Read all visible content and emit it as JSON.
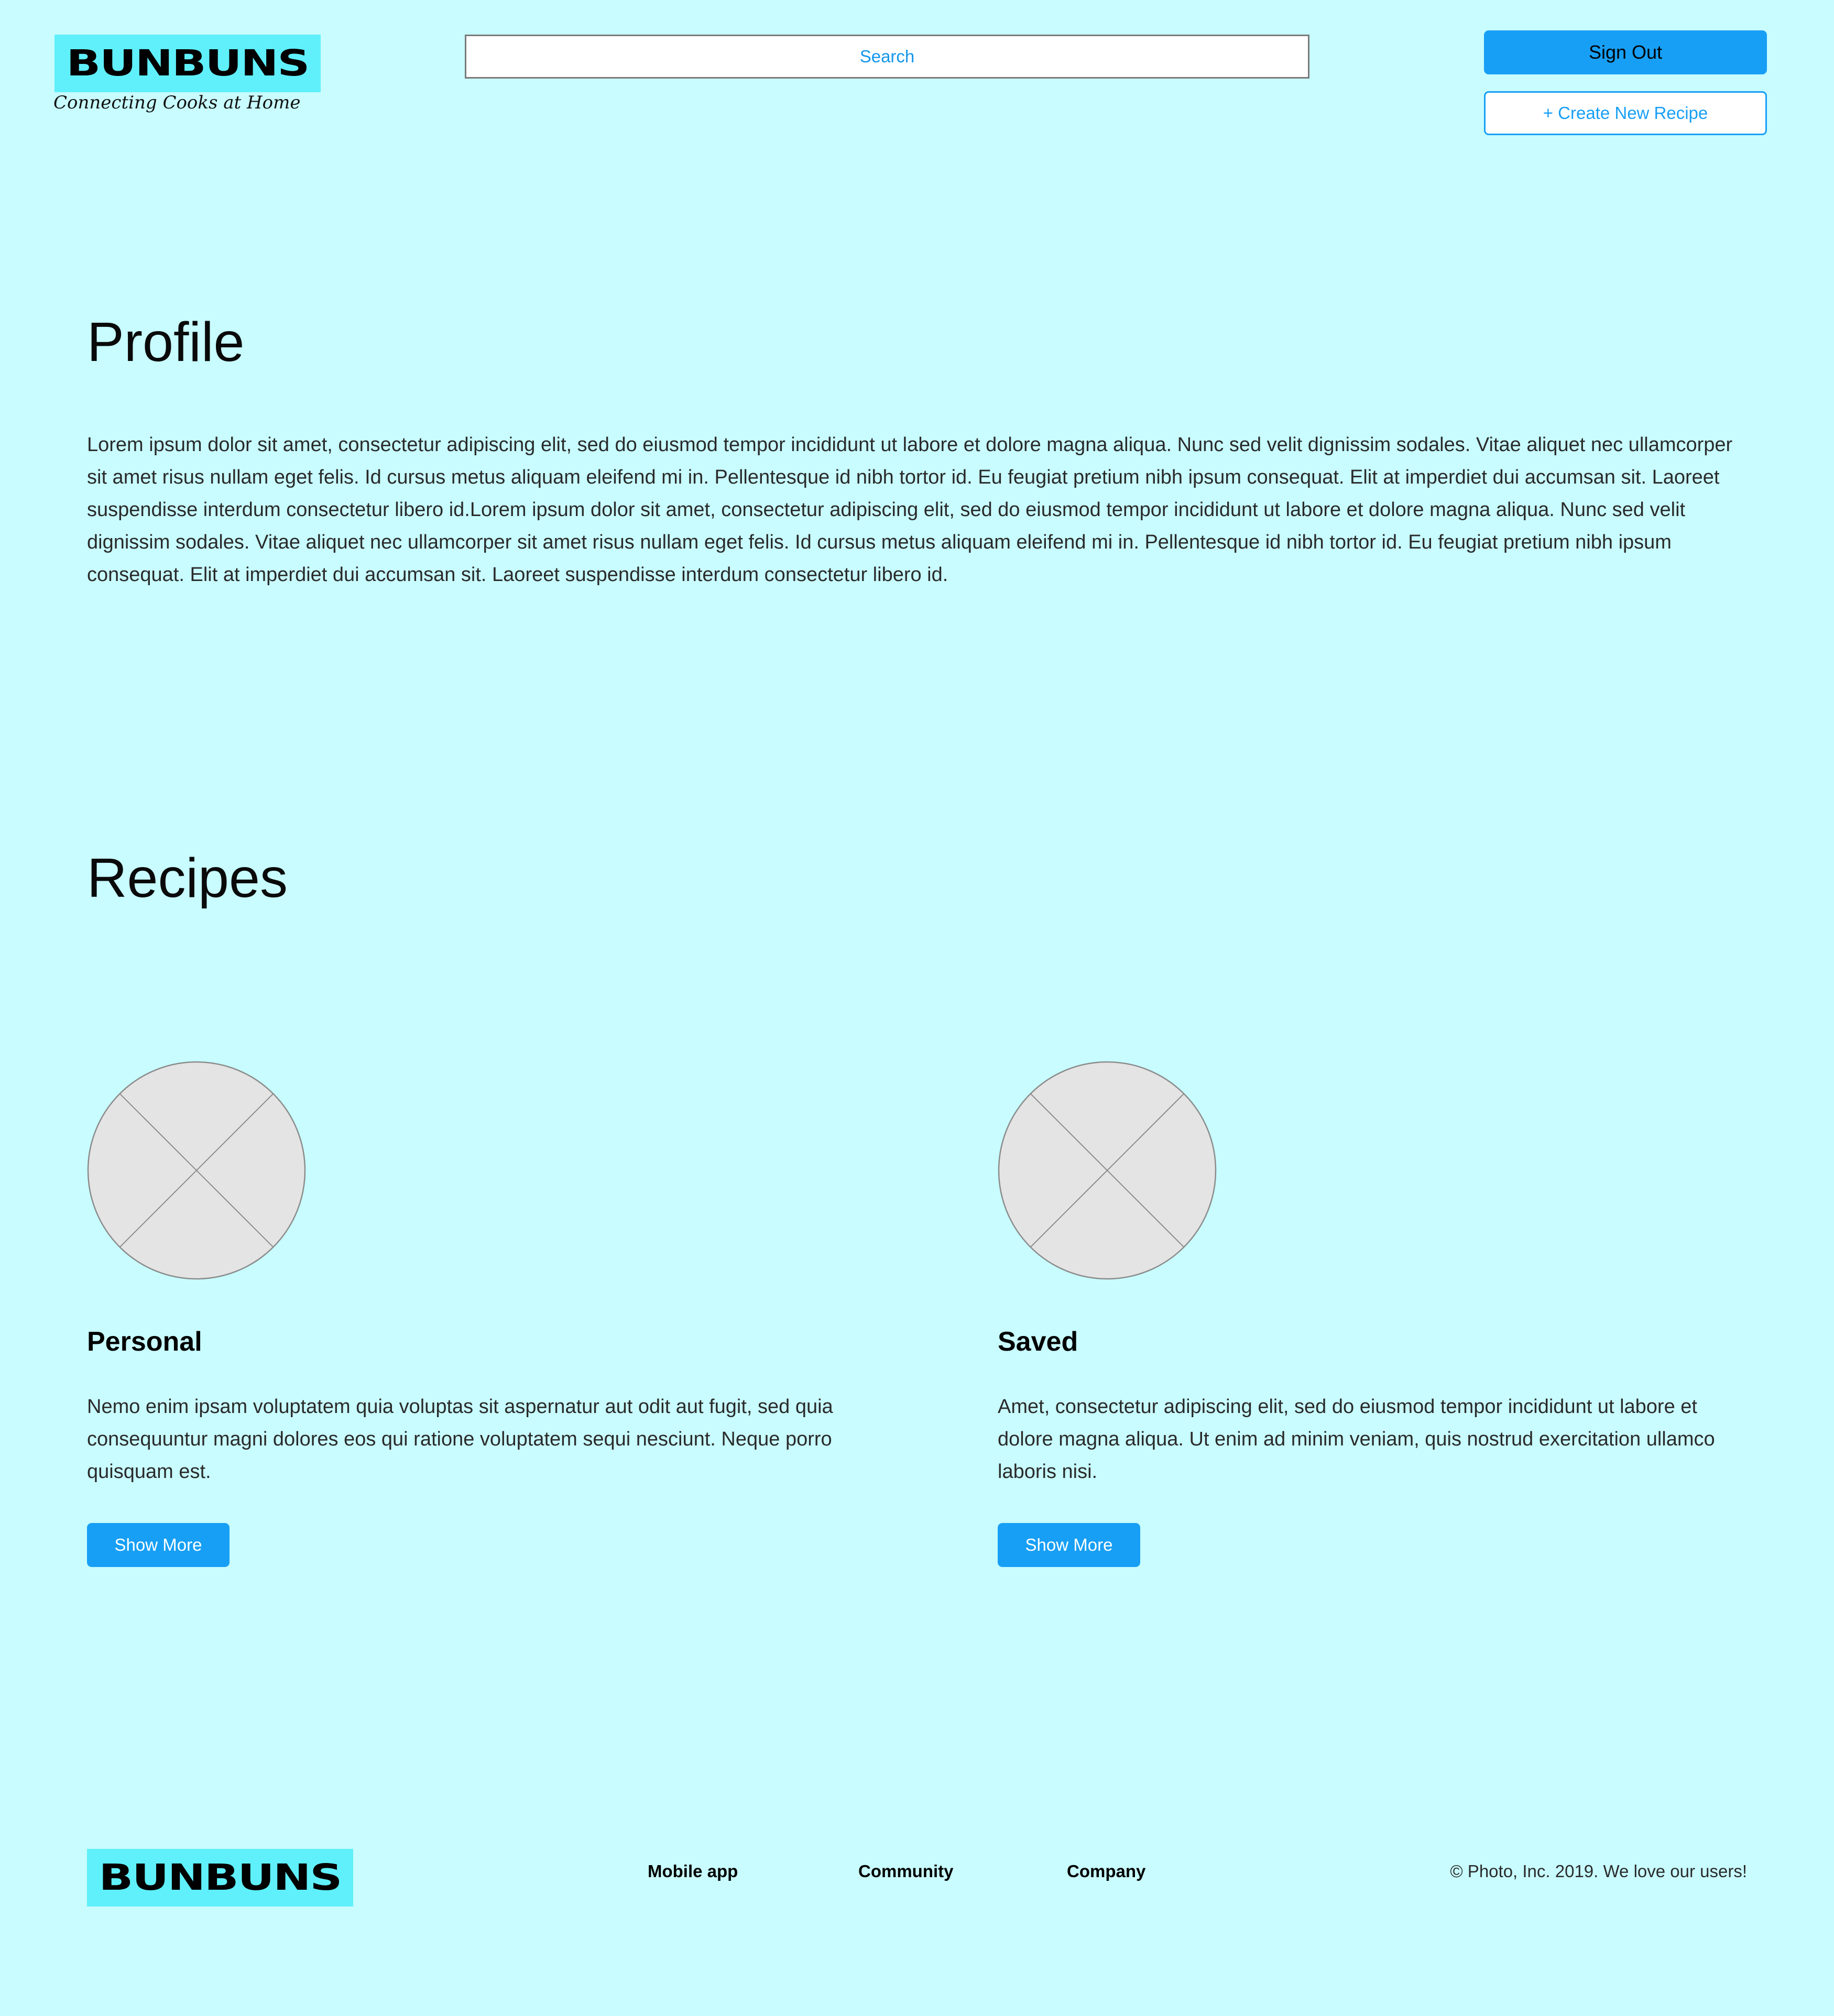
{
  "header": {
    "logo_text": "BUNBUNS",
    "tagline": "Connecting Cooks at Home",
    "search_placeholder": "Search",
    "sign_out_label": "Sign Out",
    "create_recipe_label": "+ Create New Recipe"
  },
  "profile": {
    "heading": "Profile",
    "body": "Lorem ipsum dolor sit amet, consectetur adipiscing elit, sed do eiusmod tempor incididunt ut labore et dolore magna aliqua. Nunc sed velit dignissim sodales. Vitae aliquet nec ullamcorper sit amet risus nullam eget felis. Id cursus metus aliquam eleifend mi in. Pellentesque id nibh tortor id. Eu feugiat pretium nibh ipsum consequat. Elit at imperdiet dui accumsan sit. Laoreet suspendisse interdum consectetur libero id.Lorem ipsum dolor sit amet, consectetur adipiscing elit, sed do eiusmod tempor incididunt ut labore et dolore magna aliqua. Nunc sed velit dignissim sodales. Vitae aliquet nec ullamcorper sit amet risus nullam eget felis. Id cursus metus aliquam eleifend mi in. Pellentesque id nibh tortor id. Eu feugiat pretium nibh ipsum consequat. Elit at imperdiet dui accumsan sit. Laoreet suspendisse interdum consectetur libero id."
  },
  "recipes": {
    "heading": "Recipes",
    "cards": [
      {
        "title": "Personal",
        "text": "Nemo enim ipsam voluptatem quia voluptas sit aspernatur aut odit aut fugit, sed quia consequuntur magni dolores eos qui ratione voluptatem sequi nesciunt. Neque porro quisquam est.",
        "button_label": "Show More"
      },
      {
        "title": "Saved",
        "text": "Amet, consectetur adipiscing elit, sed do eiusmod tempor incididunt ut labore et dolore magna aliqua. Ut enim ad minim veniam, quis nostrud exercitation ullamco laboris nisi.",
        "button_label": "Show More"
      }
    ]
  },
  "footer": {
    "logo_text": "BUNBUNS",
    "links": [
      "Mobile app",
      "Community",
      "Company"
    ],
    "copyright": "© Photo, Inc. 2019. We love our users!"
  },
  "colors": {
    "background": "#c8fcff",
    "logo_background": "#5ff0fb",
    "accent": "#179ff5",
    "placeholder_fill": "#e4e4e4"
  },
  "icons": {
    "card_image": "image-placeholder-icon"
  }
}
